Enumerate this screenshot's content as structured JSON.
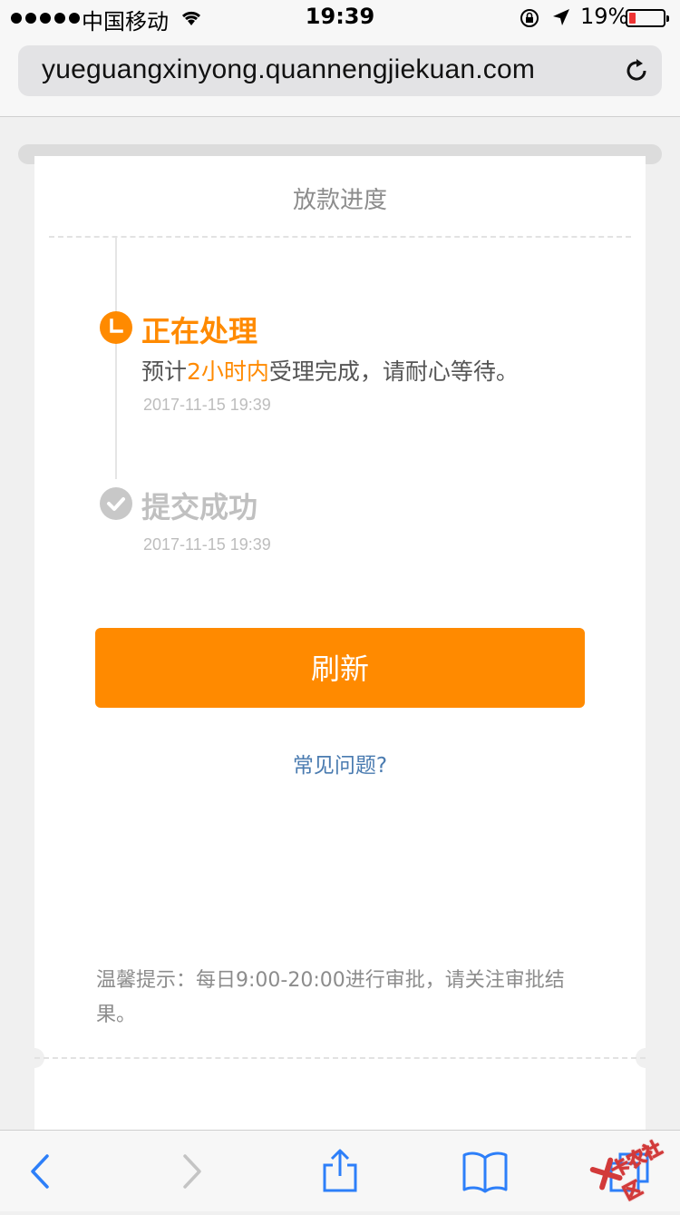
{
  "status_bar": {
    "carrier": "中国移动",
    "time": "19:39",
    "battery_percent": "19%",
    "battery_level": 0.19
  },
  "browser": {
    "url": "yueguangxinyong.quannengjiekuan.com"
  },
  "card": {
    "title": "放款进度",
    "steps": [
      {
        "title": "正在处理",
        "desc_before": "预计",
        "desc_highlight": "2小时内",
        "desc_after": "受理完成，请耐心等待。",
        "time": "2017-11-15 19:39",
        "status": "active"
      },
      {
        "title": "提交成功",
        "time": "2017-11-15 19:39",
        "status": "done"
      }
    ],
    "refresh_label": "刷新",
    "faq_label": "常见问题?",
    "notice": "温馨提示：每日9:00-20:00进行审批，请关注审批结果。"
  },
  "colors": {
    "accent": "#ff8a00",
    "link": "#4a7bb0",
    "ios_blue": "#2d7ff9"
  },
  "watermark_text": "卡农社区"
}
